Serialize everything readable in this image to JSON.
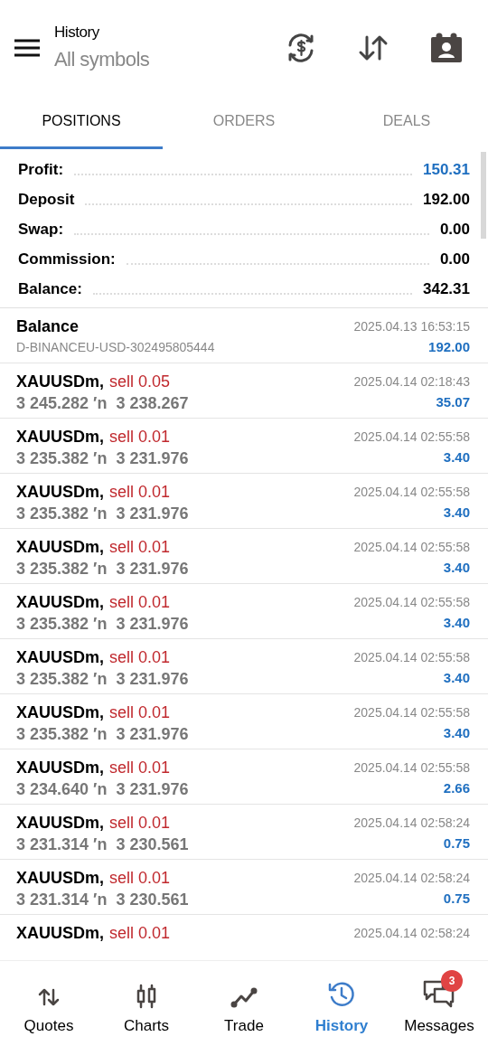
{
  "header": {
    "title": "History",
    "subtitle": "All symbols"
  },
  "tabs": [
    {
      "label": "POSITIONS",
      "selected": true
    },
    {
      "label": "ORDERS",
      "selected": false
    },
    {
      "label": "DEALS",
      "selected": false
    }
  ],
  "summary": [
    {
      "label": "Profit:",
      "value": "150.31",
      "highlight": true
    },
    {
      "label": "Deposit",
      "value": "192.00",
      "highlight": false
    },
    {
      "label": "Swap:",
      "value": "0.00",
      "highlight": false
    },
    {
      "label": "Commission:",
      "value": "0.00",
      "highlight": false
    },
    {
      "label": "Balance:",
      "value": "342.31",
      "highlight": false
    }
  ],
  "rows": [
    {
      "kind": "balance",
      "title": "Balance",
      "detail": "D-BINANCEU-USD-302495805444",
      "time": "2025.04.13 16:53:15",
      "amount": "192.00"
    },
    {
      "kind": "trade",
      "symbol": "XAUUSDm,",
      "side": "sell 0.05",
      "prices": "3 245.282 ′n  3 238.267",
      "time": "2025.04.14 02:18:43",
      "amount": "35.07"
    },
    {
      "kind": "trade",
      "symbol": "XAUUSDm,",
      "side": "sell 0.01",
      "prices": "3 235.382 ′n  3 231.976",
      "time": "2025.04.14 02:55:58",
      "amount": "3.40"
    },
    {
      "kind": "trade",
      "symbol": "XAUUSDm,",
      "side": "sell 0.01",
      "prices": "3 235.382 ′n  3 231.976",
      "time": "2025.04.14 02:55:58",
      "amount": "3.40"
    },
    {
      "kind": "trade",
      "symbol": "XAUUSDm,",
      "side": "sell 0.01",
      "prices": "3 235.382 ′n  3 231.976",
      "time": "2025.04.14 02:55:58",
      "amount": "3.40"
    },
    {
      "kind": "trade",
      "symbol": "XAUUSDm,",
      "side": "sell 0.01",
      "prices": "3 235.382 ′n  3 231.976",
      "time": "2025.04.14 02:55:58",
      "amount": "3.40"
    },
    {
      "kind": "trade",
      "symbol": "XAUUSDm,",
      "side": "sell 0.01",
      "prices": "3 235.382 ′n  3 231.976",
      "time": "2025.04.14 02:55:58",
      "amount": "3.40"
    },
    {
      "kind": "trade",
      "symbol": "XAUUSDm,",
      "side": "sell 0.01",
      "prices": "3 235.382 ′n  3 231.976",
      "time": "2025.04.14 02:55:58",
      "amount": "3.40"
    },
    {
      "kind": "trade",
      "symbol": "XAUUSDm,",
      "side": "sell 0.01",
      "prices": "3 234.640 ′n  3 231.976",
      "time": "2025.04.14 02:55:58",
      "amount": "2.66"
    },
    {
      "kind": "trade",
      "symbol": "XAUUSDm,",
      "side": "sell 0.01",
      "prices": "3 231.314 ′n  3 230.561",
      "time": "2025.04.14 02:58:24",
      "amount": "0.75"
    },
    {
      "kind": "trade",
      "symbol": "XAUUSDm,",
      "side": "sell 0.01",
      "prices": "3 231.314 ′n  3 230.561",
      "time": "2025.04.14 02:58:24",
      "amount": "0.75"
    },
    {
      "kind": "trade",
      "symbol": "XAUUSDm,",
      "side": "sell 0.01",
      "time": "2025.04.14 02:58:24"
    }
  ],
  "nav": [
    {
      "kind": "quotes",
      "label": "Quotes",
      "selected": false
    },
    {
      "kind": "charts",
      "label": "Charts",
      "selected": false
    },
    {
      "kind": "trade",
      "label": "Trade",
      "selected": false
    },
    {
      "kind": "history",
      "label": "History",
      "selected": true
    },
    {
      "kind": "messages",
      "label": "Messages",
      "selected": false,
      "badge": "3"
    }
  ]
}
